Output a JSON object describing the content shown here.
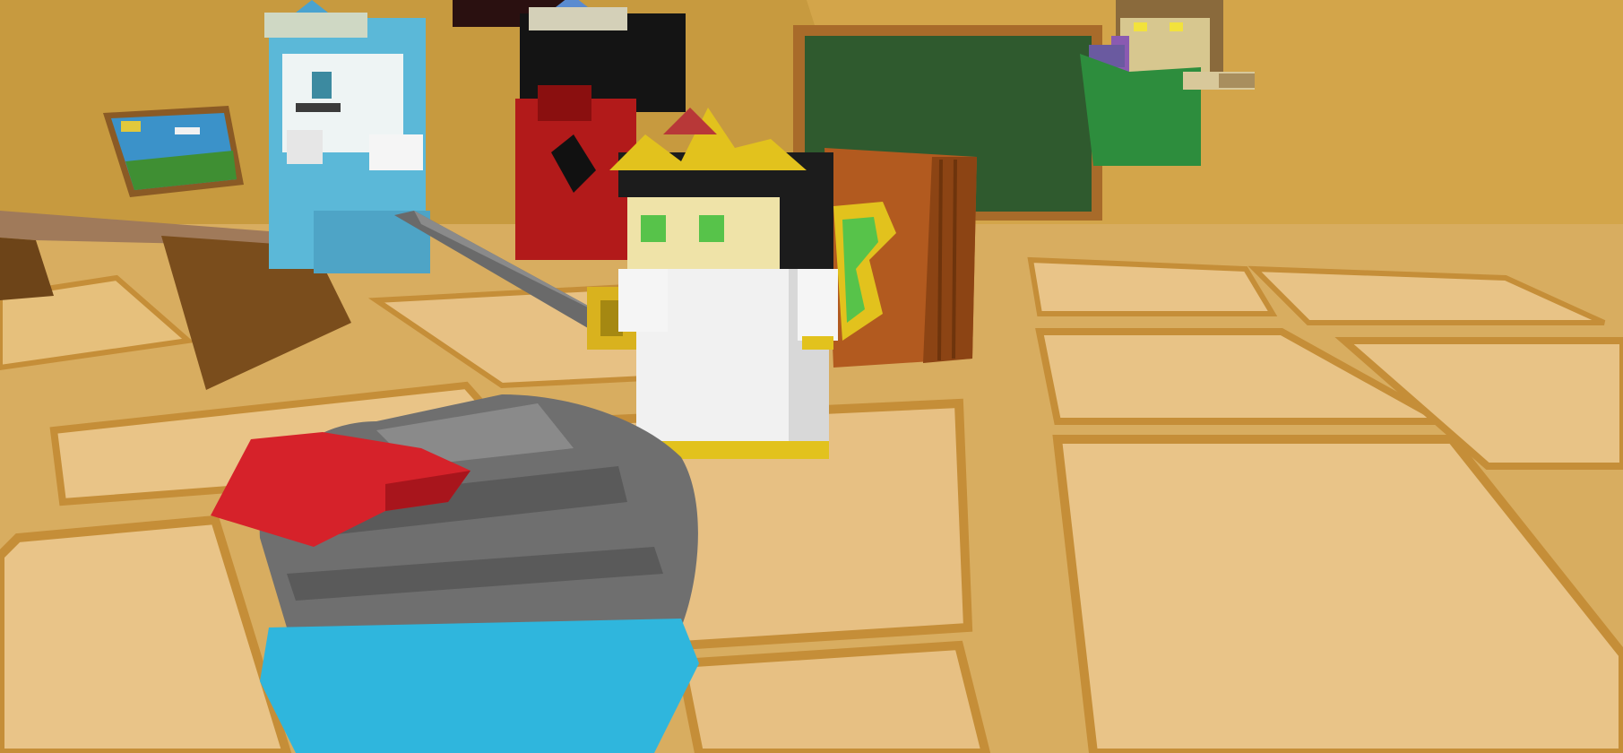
{
  "scene": {
    "palette": {
      "wall": "#c79a3f",
      "wall_light": "#d6a84b",
      "floor": "#e3bb70",
      "floor_tile": "#e7c184",
      "tile_edge": "#c99440",
      "chalkboard": "#2f5a2e",
      "chalkboard_frame": "#a86b2a",
      "desk_top": "#a07a5a",
      "desk_side": "#7a4d1c",
      "book": "#b25a1f",
      "sword": "#6a6a6a",
      "hand_guard": "#d9b21e",
      "white_robe": "#f1f1f1",
      "hair_black": "#1c1c1c",
      "skin": "#efe3a8",
      "eyes_green": "#57c34a",
      "crown_gold": "#e2c21d",
      "crown_red": "#b83838",
      "red_character": "#b21a1a",
      "blue_character": "#5bb8d8",
      "rock_gray": "#6f6f6f",
      "cap_red": "#d6222a",
      "water_blue": "#2fb6dd",
      "fairy_green": "#2d8d3d"
    },
    "objects": [
      "chalkboard",
      "wall-painting",
      "desk",
      "book-stack",
      "blue-crowned-character",
      "red-crowned-character",
      "white-robed-knight",
      "sword",
      "green-leaf-wing",
      "flying-fairy-character",
      "gray-rock-creature",
      "red-cap",
      "classroom-floor-tiles"
    ]
  }
}
